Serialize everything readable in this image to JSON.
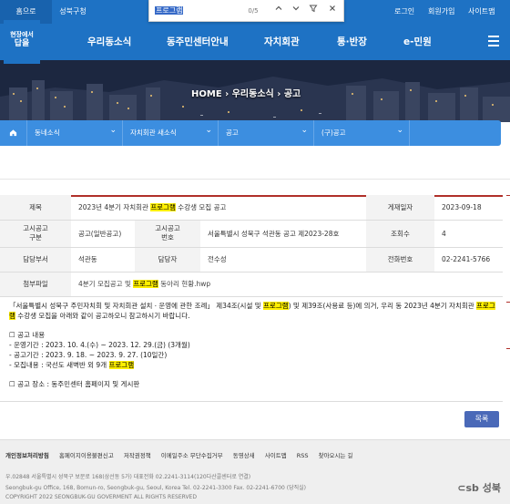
{
  "topbar": {
    "home": "홈으로",
    "seongbuk": "성북구청",
    "login": "로그인",
    "join": "회원가입",
    "sitemap": "사이트맵"
  },
  "findbar": {
    "query": "프로그램",
    "count": "0/5"
  },
  "logo": {
    "line1": "현장에서",
    "line2": "답을"
  },
  "nav": [
    "우리동소식",
    "동주민센터안내",
    "자치회관",
    "통·반장",
    "e-민원"
  ],
  "breadcrumb": "HOME  ›  우리동소식  ›  공고",
  "subnav": [
    "동네소식",
    "자치회관 새소식",
    "공고",
    "(구)공고"
  ],
  "post": {
    "labels": {
      "title": "제목",
      "date": "게재일자",
      "type": "고시공고\n구분",
      "number": "고시공고\n번호",
      "views": "조회수",
      "dept": "담당부서",
      "manager": "담당자",
      "phone": "전화번호",
      "attach": "첨부파일"
    },
    "title_pre": "2023년 4분기 자치회관 ",
    "title_hl": "프로그램",
    "title_post": " 수강생 모집 공고",
    "date": "2023-09-18",
    "type": "공고(일반공고)",
    "number": "서울특별시 성북구 석관동 공고 제2023-28호",
    "views": "4",
    "dept": "석관동",
    "manager": "전수성",
    "phone": "02-2241-5766",
    "attach_pre": "4분기 모집공고 및 ",
    "attach_hl": "프로그램",
    "attach_post": " 동아리 현황.hwp"
  },
  "body": {
    "p1a": "「서울특별시 성북구 주민자치회 및 자치회관 설치ㆍ운영에 관한 조례」 제34조(시설 및 ",
    "p1b": "프로그램",
    "p1c": ") 및 제39조(사용료 등)에 의거, 우리 동 2023년 4분기 자치회관 ",
    "p1d": "프로그램",
    "p1e": " 수강생 모집을 아래와 같이 공고하오니 참고하시기 바랍니다.",
    "s1": "☐ 공고 내용",
    "s2": "- 운영기간 : 2023. 10. 4.(수) ~ 2023. 12. 29.(금) (3개월)",
    "s3": "- 공고기간 : 2023. 9. 18. ~ 2023. 9. 27. (10일간)",
    "s4a": "- 모집내용 : 국선도 새벽반 외 9개 ",
    "s4b": "프로그램",
    "s5": "☐ 공고 장소 : 동주민센터 홈페이지 및 게시판"
  },
  "list_button": "목록",
  "footer": {
    "links": [
      "개인정보처리방침",
      "홈페이지이용불편신고",
      "저작권정책",
      "이메일주소 무단수집거부",
      "동영상새",
      "사이트맵",
      "RSS",
      "찾아오시는 길"
    ],
    "addr1": "우.02848 서울특별시 성북구 보문로 168(삼선동 5가) 대표전화 02.2241-3114(120다산콜센터로 연결)",
    "addr2": "Seongbuk-gu Office, 168, Bomun-ro, Seongbuk-gu, Seoul, Korea Tel. 02-2241-3300 Fax. 02-2241-6700 (당직실)",
    "copyright": "COPYRIGHT 2022 SEONGBUK-GU GOVERMENT ALL RIGHTS RESERVED",
    "brand": "⊂sb 성북"
  }
}
